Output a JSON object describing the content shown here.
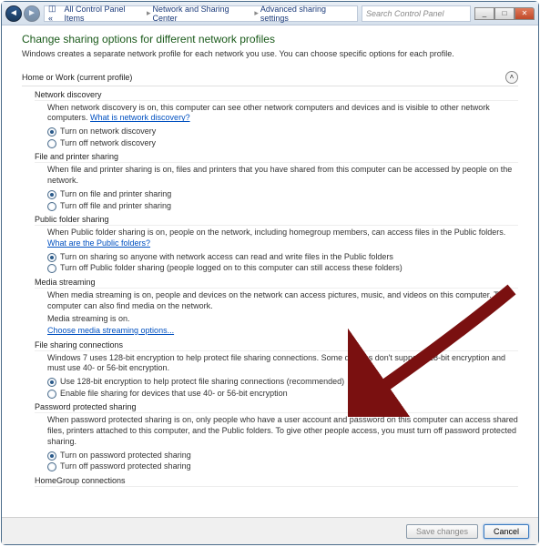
{
  "titlebar": {
    "breadcrumb": [
      "All Control Panel Items",
      "Network and Sharing Center",
      "Advanced sharing settings"
    ],
    "search_placeholder": "Search Control Panel"
  },
  "page": {
    "title": "Change sharing options for different network profiles",
    "subtitle": "Windows creates a separate network profile for each network you use. You can choose specific options for each profile."
  },
  "profile_header": "Home or Work (current profile)",
  "sections": {
    "network_discovery": {
      "title": "Network discovery",
      "desc": "When network discovery is on, this computer can see other network computers and devices and is visible to other network computers. ",
      "link": "What is network discovery?",
      "opt_on": "Turn on network discovery",
      "opt_off": "Turn off network discovery"
    },
    "file_printer": {
      "title": "File and printer sharing",
      "desc": "When file and printer sharing is on, files and printers that you have shared from this computer can be accessed by people on the network.",
      "opt_on": "Turn on file and printer sharing",
      "opt_off": "Turn off file and printer sharing"
    },
    "public_folder": {
      "title": "Public folder sharing",
      "desc": "When Public folder sharing is on, people on the network, including homegroup members, can access files in the Public folders. ",
      "link": "What are the Public folders?",
      "opt_on": "Turn on sharing so anyone with network access can read and write files in the Public folders",
      "opt_off": "Turn off Public folder sharing (people logged on to this computer can still access these folders)"
    },
    "media_streaming": {
      "title": "Media streaming",
      "desc": "When media streaming is on, people and devices on the network can access pictures, music, and videos on this computer. This computer can also find media on the network.",
      "status": "Media streaming is on.",
      "link": "Choose media streaming options..."
    },
    "file_sharing_conn": {
      "title": "File sharing connections",
      "desc": "Windows 7 uses 128-bit encryption to help protect file sharing connections. Some devices don't support 128-bit encryption and must use 40- or 56-bit encryption.",
      "opt_on": "Use 128-bit encryption to help protect file sharing connections (recommended)",
      "opt_off": "Enable file sharing for devices that use 40- or 56-bit encryption"
    },
    "password_protected": {
      "title": "Password protected sharing",
      "desc": "When password protected sharing is on, only people who have a user account and password on this computer can access shared files, printers attached to this computer, and the Public folders. To give other people access, you must turn off password protected sharing.",
      "opt_on": "Turn on password protected sharing",
      "opt_off": "Turn off password protected sharing"
    },
    "homegroup": {
      "title": "HomeGroup connections"
    }
  },
  "footer": {
    "save": "Save changes",
    "cancel": "Cancel"
  }
}
